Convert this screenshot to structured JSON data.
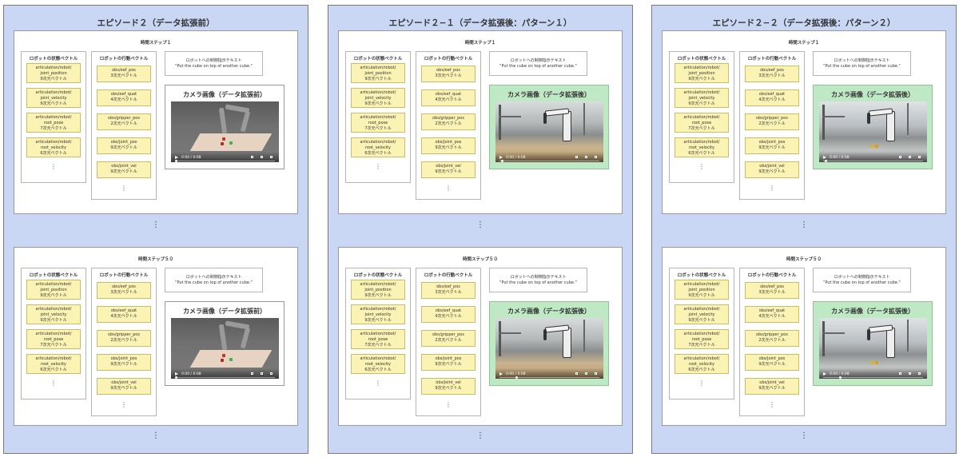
{
  "panels": [
    {
      "title": "エピソード２（データ拡張前）",
      "camera_title": "カメラ画像（データ拡張前）",
      "augmented": false
    },
    {
      "title": "エピソード２−１（データ拡張後：パターン１）",
      "camera_title": "カメラ画像（データ拡張後）",
      "augmented": true
    },
    {
      "title": "エピソード２−２（データ拡張後：パターン２）",
      "camera_title": "カメラ画像（データ拡張後）",
      "augmented": true
    }
  ],
  "steps": [
    "時間ステップ１",
    "時間ステップ５０"
  ],
  "state_header": "ロボットの状態ベクトル",
  "action_header": "ロボットの行動ベクトル",
  "prompt_header": "ロボットへの制御指示テキスト",
  "prompt_text": "\"Put the cube on top of another cube.\"",
  "state_items": [
    [
      "articulation/robot/",
      "joint_position",
      "9次元ベクトル"
    ],
    [
      "articulation/robot/",
      "joint_velocity",
      "9次元ベクトル"
    ],
    [
      "articulation/robot/",
      "root_pose",
      "7次元ベクトル"
    ],
    [
      "articulation/robot/",
      "root_velocity",
      "6次元ベクトル"
    ]
  ],
  "action_items": [
    [
      "obs/eef_pos",
      "3次元ベクトル"
    ],
    [
      "obs/eef_quat",
      "4次元ベクトル"
    ],
    [
      "obs/gripper_pos",
      "2次元ベクトル"
    ],
    [
      "obs/joint_pos",
      "9次元ベクトル"
    ],
    [
      "obs/joint_vel",
      "9次元ベクトル"
    ]
  ],
  "video_time": "0:00 / 0:08",
  "ellipsis": "⋮",
  "colors": {
    "panel_bg": "#c9d7f4",
    "item_bg": "#fbf3b4",
    "augmented_camera_bg": "#bfe8c4"
  }
}
